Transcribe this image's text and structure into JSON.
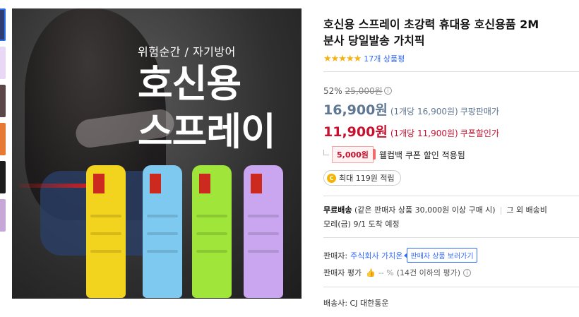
{
  "thumbnails": [
    {
      "color": "#2f3e72",
      "active": true
    },
    {
      "color": "#e8d7f5"
    },
    {
      "color": "#5b4747"
    },
    {
      "color": "#e67a33"
    },
    {
      "color": "#1c1c1c"
    },
    {
      "color": "#c7a6d8"
    }
  ],
  "hero": {
    "subtitle": "위험순간 / 자기방어",
    "headline_1": "호신용",
    "headline_2": "스프레이",
    "spray_colors": [
      "#f2d31d",
      "#7ec9ef",
      "#9fe53a",
      "#c9a6ef"
    ]
  },
  "product": {
    "title_line1": "호신용 스프레이 초강력 휴대용 호신용품 2M",
    "title_line2": "분사 당일발송 가치픽",
    "stars": "★★★★★",
    "review_count": "17개 상품평"
  },
  "price": {
    "discount_rate": "52%",
    "original": "25,000원",
    "coupang_price": "16,900원",
    "coupang_unit": "(1개당 16,900원)",
    "coupang_label": "쿠팡판매가",
    "coupon_price": "11,900원",
    "coupon_unit": "(1개당 11,900원)",
    "coupon_label": "쿠폰할인가",
    "coupon_amount": "5,000원",
    "coupon_text": "웰컴백 쿠폰 할인 적용됨",
    "cashback_icon": "C",
    "cashback": "최대 119원 적립"
  },
  "shipping": {
    "free_label": "무료배송",
    "condition": "(같은 판매자 상품 30,000원 이상 구매 시)",
    "other_fee": "그 외 배송비",
    "eta": "모레(금) 9/1 도착 예정"
  },
  "seller": {
    "label": "판매자:",
    "name": "주식회사 가치온",
    "tooltip": "판매자 상품 보러가기",
    "eval_label": "판매자 평가",
    "eval_value": "-- %",
    "eval_note": "(14건 이하의 평가)",
    "courier": "배송사: CJ 대한통운"
  }
}
